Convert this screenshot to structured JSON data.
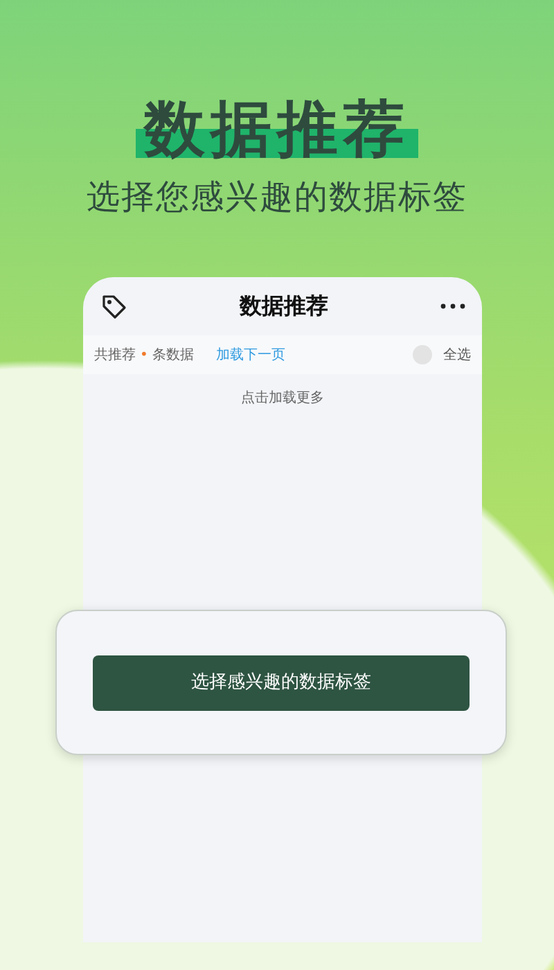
{
  "promo": {
    "headline": "数据推荐",
    "subtitle": "选择您感兴趣的数据标签"
  },
  "phone": {
    "title": "数据推荐",
    "toolbar": {
      "count_prefix": "共推荐",
      "count": "•",
      "count_suffix": "条数据",
      "load_next": "加载下一页",
      "select_all": {
        "label": "全选",
        "checked": false
      }
    },
    "load_more": "点击加载更多"
  },
  "dialog": {
    "button": "选择感兴趣的数据标签"
  }
}
